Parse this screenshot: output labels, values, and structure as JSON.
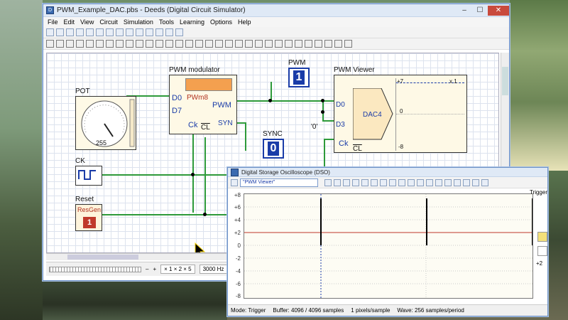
{
  "window": {
    "title": "PWM_Example_DAC.pbs - Deeds (Digital Circuit Simulator)",
    "min": "–",
    "max": "☐",
    "close": "✕"
  },
  "menu": [
    "File",
    "Edit",
    "View",
    "Circuit",
    "Simulation",
    "Tools",
    "Learning",
    "Options",
    "Help"
  ],
  "circuit": {
    "pot": {
      "label": "POT",
      "value": "255"
    },
    "pwm_mod": {
      "label": "PWM modulator",
      "name": "PWm8",
      "d0": "D0",
      "d7": "D7",
      "pwm": "PWM",
      "syn": "SYN",
      "ck": "Ck",
      "cl": "CL"
    },
    "pwm_out": {
      "label": "PWM",
      "value": "1"
    },
    "sync": {
      "label": "SYNC",
      "value": "0"
    },
    "viewer": {
      "label": "PWM Viewer",
      "d0": "D0",
      "d3": "D3",
      "ck": "Ck",
      "cl": "CL",
      "dac": "DAC4",
      "top": "+7",
      "mid": "0",
      "bot": "-8",
      "scale": "x 1",
      "zero": "'0'"
    },
    "ck": {
      "label": "CK"
    },
    "reset": {
      "label": "Reset",
      "name": "ResGen",
      "value": "1"
    }
  },
  "status": {
    "zoom": "× 1 × 2 × 5",
    "freq": "3000 Hz",
    "minus": "–",
    "plus": "+"
  },
  "dso": {
    "title": "Digital Storage Oscilloscope (DSO)",
    "probe": "\"PWM Viewer\"",
    "yticks": [
      "+8",
      "+6",
      "+4",
      "+2",
      "0",
      "-2",
      "-4",
      "-6",
      "-8"
    ],
    "trigger": "Trigger",
    "trig_value": "+2",
    "status": {
      "mode": "Mode: Trigger",
      "buffer": "Buffer: 4096 / 4096 samples",
      "rate": "1 pixels/sample",
      "wave": "Wave: 256 samples/period"
    }
  },
  "colors": {
    "wire": "#2e9a3a",
    "display": "#1a3ca8",
    "trace": "#c0392b"
  }
}
